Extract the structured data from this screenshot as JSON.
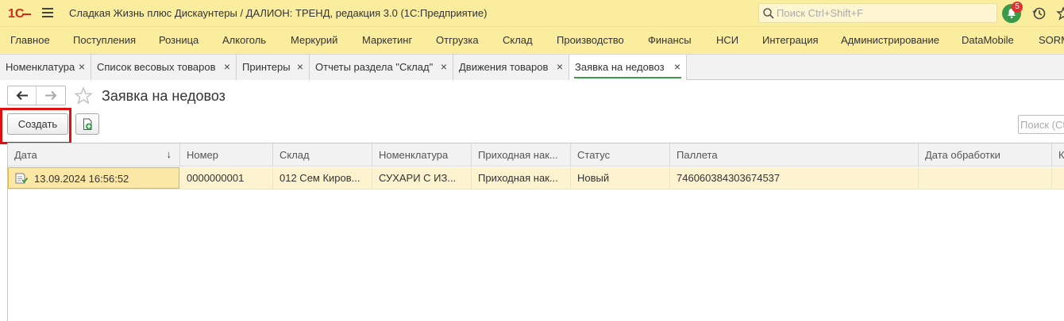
{
  "app": {
    "title": "Сладкая Жизнь плюс Дискаунтеры / ДАЛИОН: ТРЕНД, редакция 3.0  (1С:Предприятие)",
    "search_placeholder": "Поиск Ctrl+Shift+F",
    "notifications_count": "5"
  },
  "menu": {
    "items": [
      {
        "label": "Главное"
      },
      {
        "label": "Поступления"
      },
      {
        "label": "Розница"
      },
      {
        "label": "Алкоголь"
      },
      {
        "label": "Меркурий"
      },
      {
        "label": "Маркетинг"
      },
      {
        "label": "Отгрузка"
      },
      {
        "label": "Склад"
      },
      {
        "label": "Производство"
      },
      {
        "label": "Финансы"
      },
      {
        "label": "НСИ"
      },
      {
        "label": "Интеграция"
      },
      {
        "label": "Администрирование"
      },
      {
        "label": "DataMobile"
      },
      {
        "label": "SORM"
      }
    ]
  },
  "tabs": [
    {
      "label": "Номенклатура",
      "close": "×"
    },
    {
      "label": "Список весовых товаров",
      "close": "×"
    },
    {
      "label": "Принтеры",
      "close": "×"
    },
    {
      "label": "Отчеты раздела \"Склад\"",
      "close": "×"
    },
    {
      "label": "Движения товаров",
      "close": "×"
    },
    {
      "label": "Заявка на недовоз",
      "close": "×"
    }
  ],
  "form": {
    "title": "Заявка на недовоз",
    "create_label": "Создать",
    "search_placeholder": "Поиск (Ctrl+F)"
  },
  "table": {
    "columns": [
      "Дата",
      "Номер",
      "Склад",
      "Номенклатура",
      "Приходная нак...",
      "Статус",
      "Паллета",
      "Дата обработки",
      "К"
    ],
    "sort_indicator": "↓",
    "rows": [
      {
        "date": "13.09.2024 16:56:52",
        "number": "0000000001",
        "warehouse": "012 Сем Киров...",
        "nomenclature": "СУХАРИ С ИЗ...",
        "invoice": "Приходная нак...",
        "status": "Новый",
        "pallet": "746060384303674537",
        "processed": ""
      }
    ]
  },
  "colors": {
    "title_bg": "#fbed9e",
    "accent_green": "#3a9a4a",
    "highlight_red": "#e01010",
    "row_selected": "#fdf3cf"
  }
}
